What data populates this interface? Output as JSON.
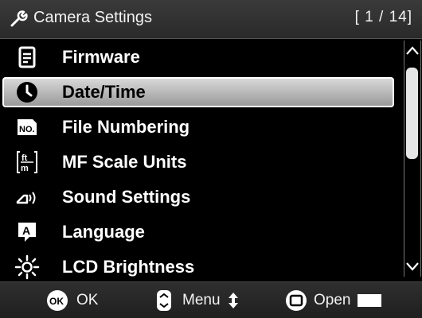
{
  "header": {
    "icon": "wrench-icon",
    "title": "Camera Settings",
    "page_indicator": "[ 1 / 14]"
  },
  "menu": {
    "selected_index": 1,
    "items": [
      {
        "label": "Firmware",
        "icon": "firmware-icon"
      },
      {
        "label": "Date/Time",
        "icon": "clock-icon"
      },
      {
        "label": "File Numbering",
        "icon": "file-numbering-icon"
      },
      {
        "label": "MF Scale Units",
        "icon": "mf-scale-units-icon"
      },
      {
        "label": "Sound Settings",
        "icon": "speaker-icon"
      },
      {
        "label": "Language",
        "icon": "language-icon"
      },
      {
        "label": "LCD Brightness",
        "icon": "brightness-icon"
      }
    ]
  },
  "scrollbar": {
    "position_fraction": 0.0,
    "thumb_fraction": 0.5
  },
  "footer": {
    "ok_label": "OK",
    "menu_label": "Menu",
    "open_label": "Open"
  }
}
